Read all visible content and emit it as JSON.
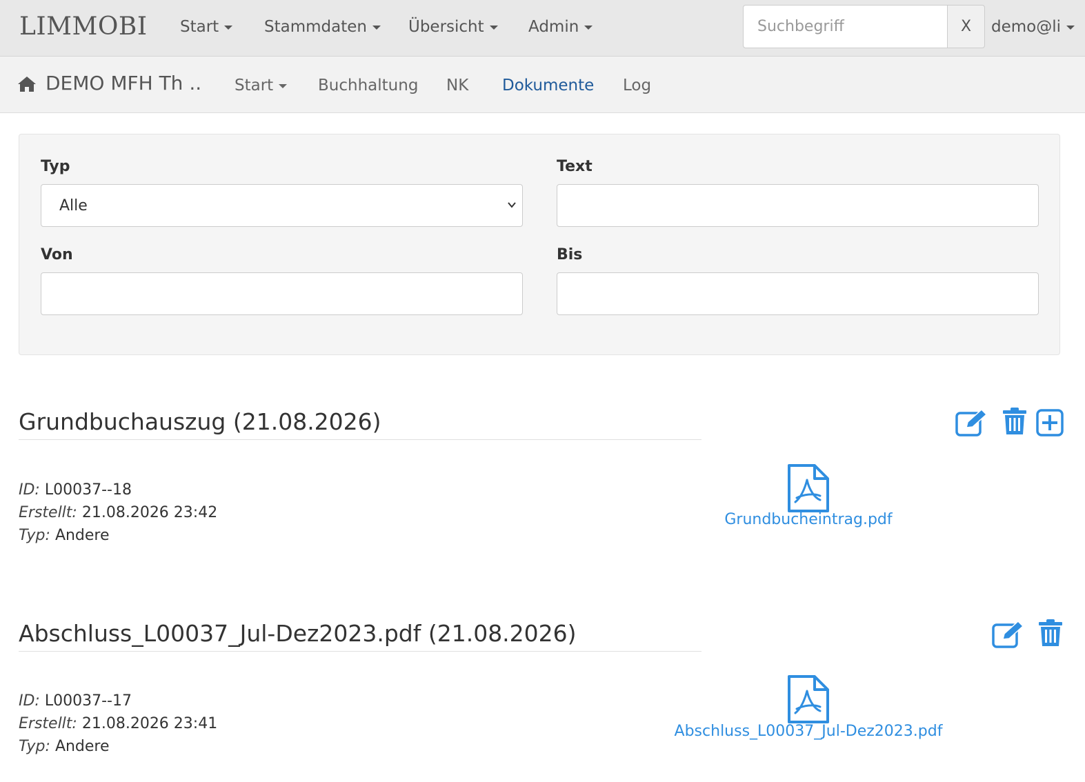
{
  "topbar": {
    "brand": "LIMMOBI",
    "menu": [
      {
        "label": "Start"
      },
      {
        "label": "Stammdaten"
      },
      {
        "label": "Übersicht"
      },
      {
        "label": "Admin"
      }
    ],
    "search": {
      "placeholder": "Suchbegriff",
      "value": "",
      "clear_label": "X"
    },
    "user": "demo@li"
  },
  "subbar": {
    "home_icon": "home-icon",
    "property_title": "DEMO MFH Th ..",
    "menu": [
      {
        "label": "Start",
        "dropdown": true
      },
      {
        "label": "Buchhaltung"
      },
      {
        "label": "NK"
      },
      {
        "label": "Dokumente",
        "active": true
      },
      {
        "label": "Log"
      }
    ]
  },
  "filters": {
    "typ": {
      "label": "Typ",
      "value": "Alle"
    },
    "text": {
      "label": "Text",
      "value": ""
    },
    "von": {
      "label": "Von",
      "value": ""
    },
    "bis": {
      "label": "Bis",
      "value": ""
    }
  },
  "documents": [
    {
      "title": "Grundbuchauszug (21.08.2026)",
      "id_label": "ID:",
      "id": "L00037--18",
      "created_label": "Erstellt:",
      "created": "21.08.2026 23:42",
      "type_label": "Typ:",
      "type": "Andere",
      "file": "Grundbucheintrag.pdf",
      "actions": [
        "edit-icon",
        "trash-icon",
        "plus-square-icon"
      ]
    },
    {
      "title": "Abschluss_L00037_Jul-Dez2023.pdf (21.08.2026)",
      "id_label": "ID:",
      "id": "L00037--17",
      "created_label": "Erstellt:",
      "created": "21.08.2026 23:41",
      "type_label": "Typ:",
      "type": "Andere",
      "file": "Abschluss_L00037_Jul-Dez2023.pdf",
      "actions": [
        "edit-icon",
        "trash-icon"
      ]
    }
  ],
  "colors": {
    "accent": "#2f8ee0",
    "active_nav": "#1f5a9a",
    "topbar_bg": "#e8e8e8",
    "subbar_bg": "#f2f2f2"
  }
}
